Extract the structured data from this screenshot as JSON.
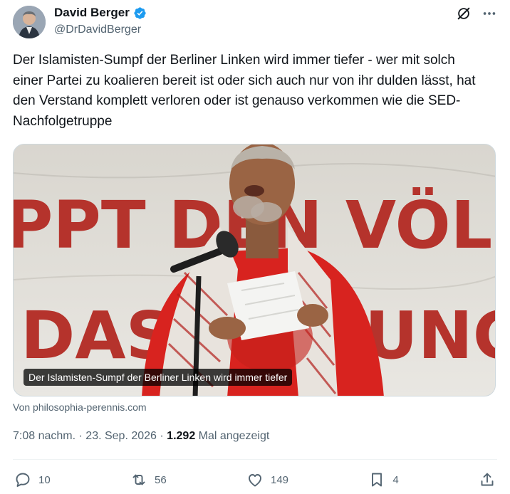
{
  "author": {
    "name": "David Berger",
    "handle": "@DrDavidBerger"
  },
  "tweet": {
    "text": "Der Islamisten-Sumpf der Berliner Linken wird immer tiefer - wer mit solch einer Partei zu koalieren bereit ist oder sich auch nur von ihr dulden lässt, hat den Verstand komplett verloren oder ist genauso verkommen wie die SED-Nachfolgetruppe",
    "media_caption": "Der Islamisten-Sumpf der Berliner Linken wird immer tiefer",
    "banner_text_top": "PPT DEN VÖLK",
    "banner_text_bottom": "DAS      NUNG",
    "source": "Von philosophia-perennis.com",
    "time": "7:08 nachm.",
    "date": "23. Sep. 2026",
    "views_count": "1.292",
    "views_label": "Mal angezeigt"
  },
  "actions": {
    "replies": "10",
    "reposts": "56",
    "likes": "149",
    "bookmarks": "4"
  },
  "icons": [
    "verified-badge-icon",
    "grok-icon",
    "more-icon",
    "reply-icon",
    "repost-icon",
    "like-icon",
    "bookmark-icon",
    "share-icon"
  ],
  "colors": {
    "verified": "#1d9bf0",
    "muted": "#536471",
    "text": "#0f1419",
    "banner_red": "#b5332c",
    "shirt_red": "#d8231f"
  }
}
